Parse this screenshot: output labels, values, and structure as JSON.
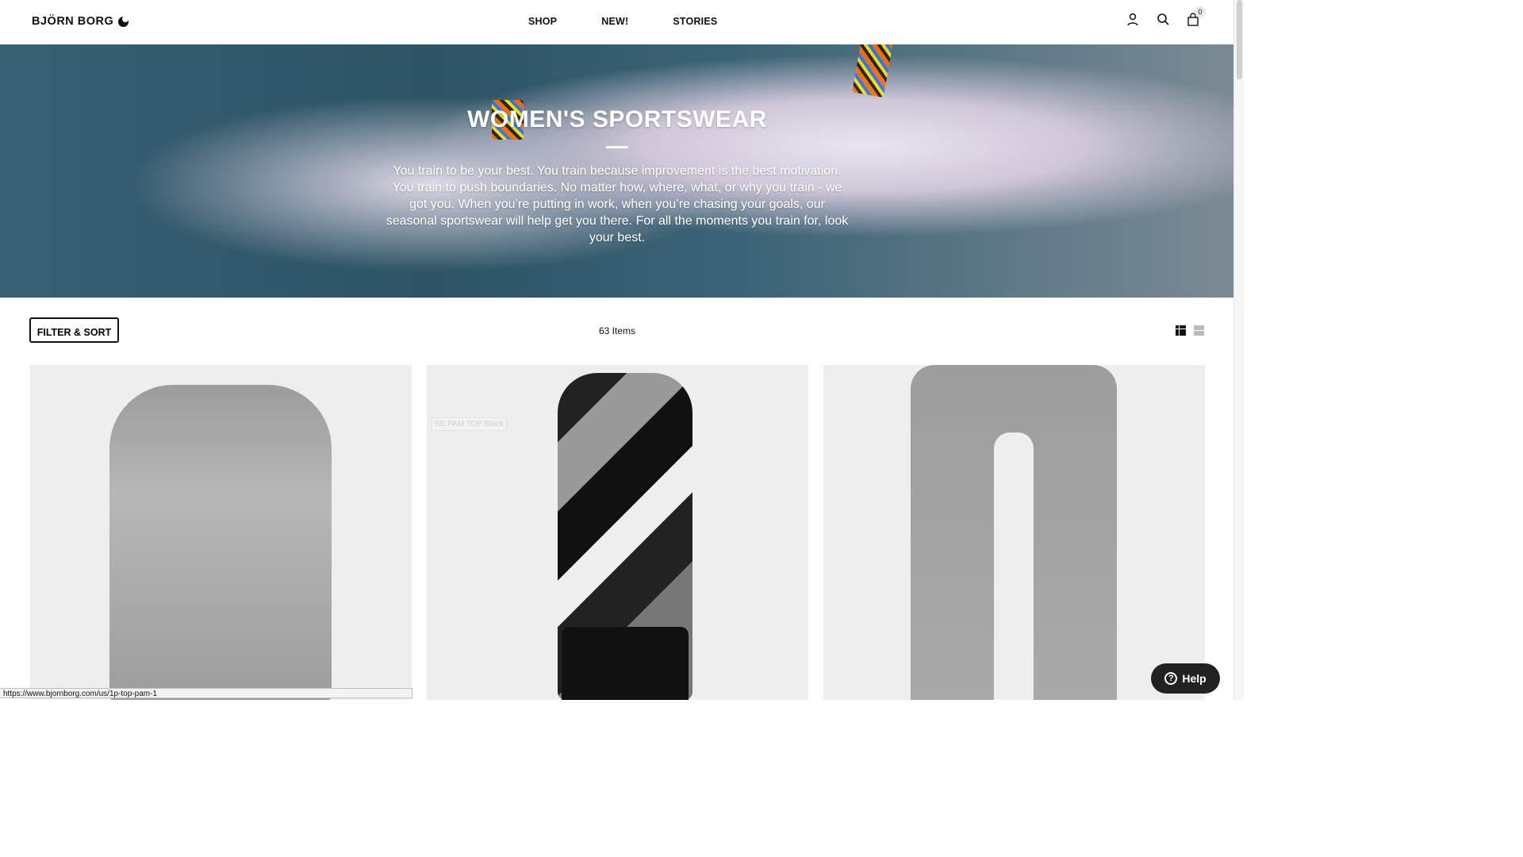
{
  "header": {
    "brand": "BJÖRN BORG",
    "nav": [
      "SHOP",
      "NEW!",
      "STORIES"
    ],
    "cart_count": "0",
    "icons": [
      "user-icon",
      "search-icon",
      "cart-icon"
    ]
  },
  "hero": {
    "title": "WOMEN'S SPORTSWEAR",
    "description": "You train to be your best. You train because improvement is the best motivation. You train to push boundaries. No matter how, where, what, or why you train - we got you. When you’re putting in work, when you’re chasing your goals, our seasonal sportswear will help get you there. For all the moments you train for, look your best."
  },
  "toolbar": {
    "filter_label": "FILTER & SORT",
    "items_count": "63 Items",
    "view_icons": [
      "grid-view-icon",
      "list-view-icon"
    ]
  },
  "products": [
    {
      "image_name": "grey-sweatshirt-tee"
    },
    {
      "image_name": "printed-tank-top",
      "ghost_label": "BB PAM TOP Black"
    },
    {
      "image_name": "grey-sweatpants"
    }
  ],
  "status_url": "https://www.bjornborg.com/us/1p-top-pam-1",
  "help": {
    "label": "Help"
  }
}
